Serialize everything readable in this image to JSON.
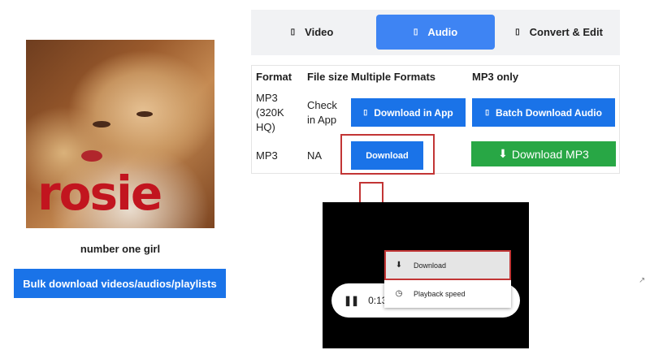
{
  "cover": {
    "art_word": "rosie"
  },
  "song": {
    "title": "number one girl"
  },
  "bulk_button": "Bulk download videos/audios/playlists",
  "tabs": [
    {
      "label": "Video",
      "icon": "video-icon",
      "selected": false
    },
    {
      "label": "Audio",
      "icon": "audio-icon",
      "selected": true
    },
    {
      "label": "Convert & Edit",
      "icon": "edit-icon",
      "selected": false
    }
  ],
  "table": {
    "headers": [
      "Format",
      "File size",
      "Multiple Formats",
      "MP3 only"
    ],
    "rows": [
      {
        "format": "MP3\n(320K\nHQ)",
        "size": "Check\nin App",
        "multi": "Download in App",
        "mp3": "Batch Download Audio"
      },
      {
        "format": "MP3",
        "size": "NA",
        "multi": "Download",
        "mp3": "Download MP3"
      }
    ]
  },
  "player": {
    "time": "0:13 /",
    "menu": [
      {
        "label": "Download",
        "icon": "download-icon",
        "highlighted": true
      },
      {
        "label": "Playback speed",
        "icon": "playback-speed-icon",
        "highlighted": false
      }
    ]
  },
  "colors": {
    "primary_blue": "#1a73e8",
    "tab_selected": "#3e84f3",
    "green": "#28a745",
    "highlight_red": "#c23535"
  }
}
